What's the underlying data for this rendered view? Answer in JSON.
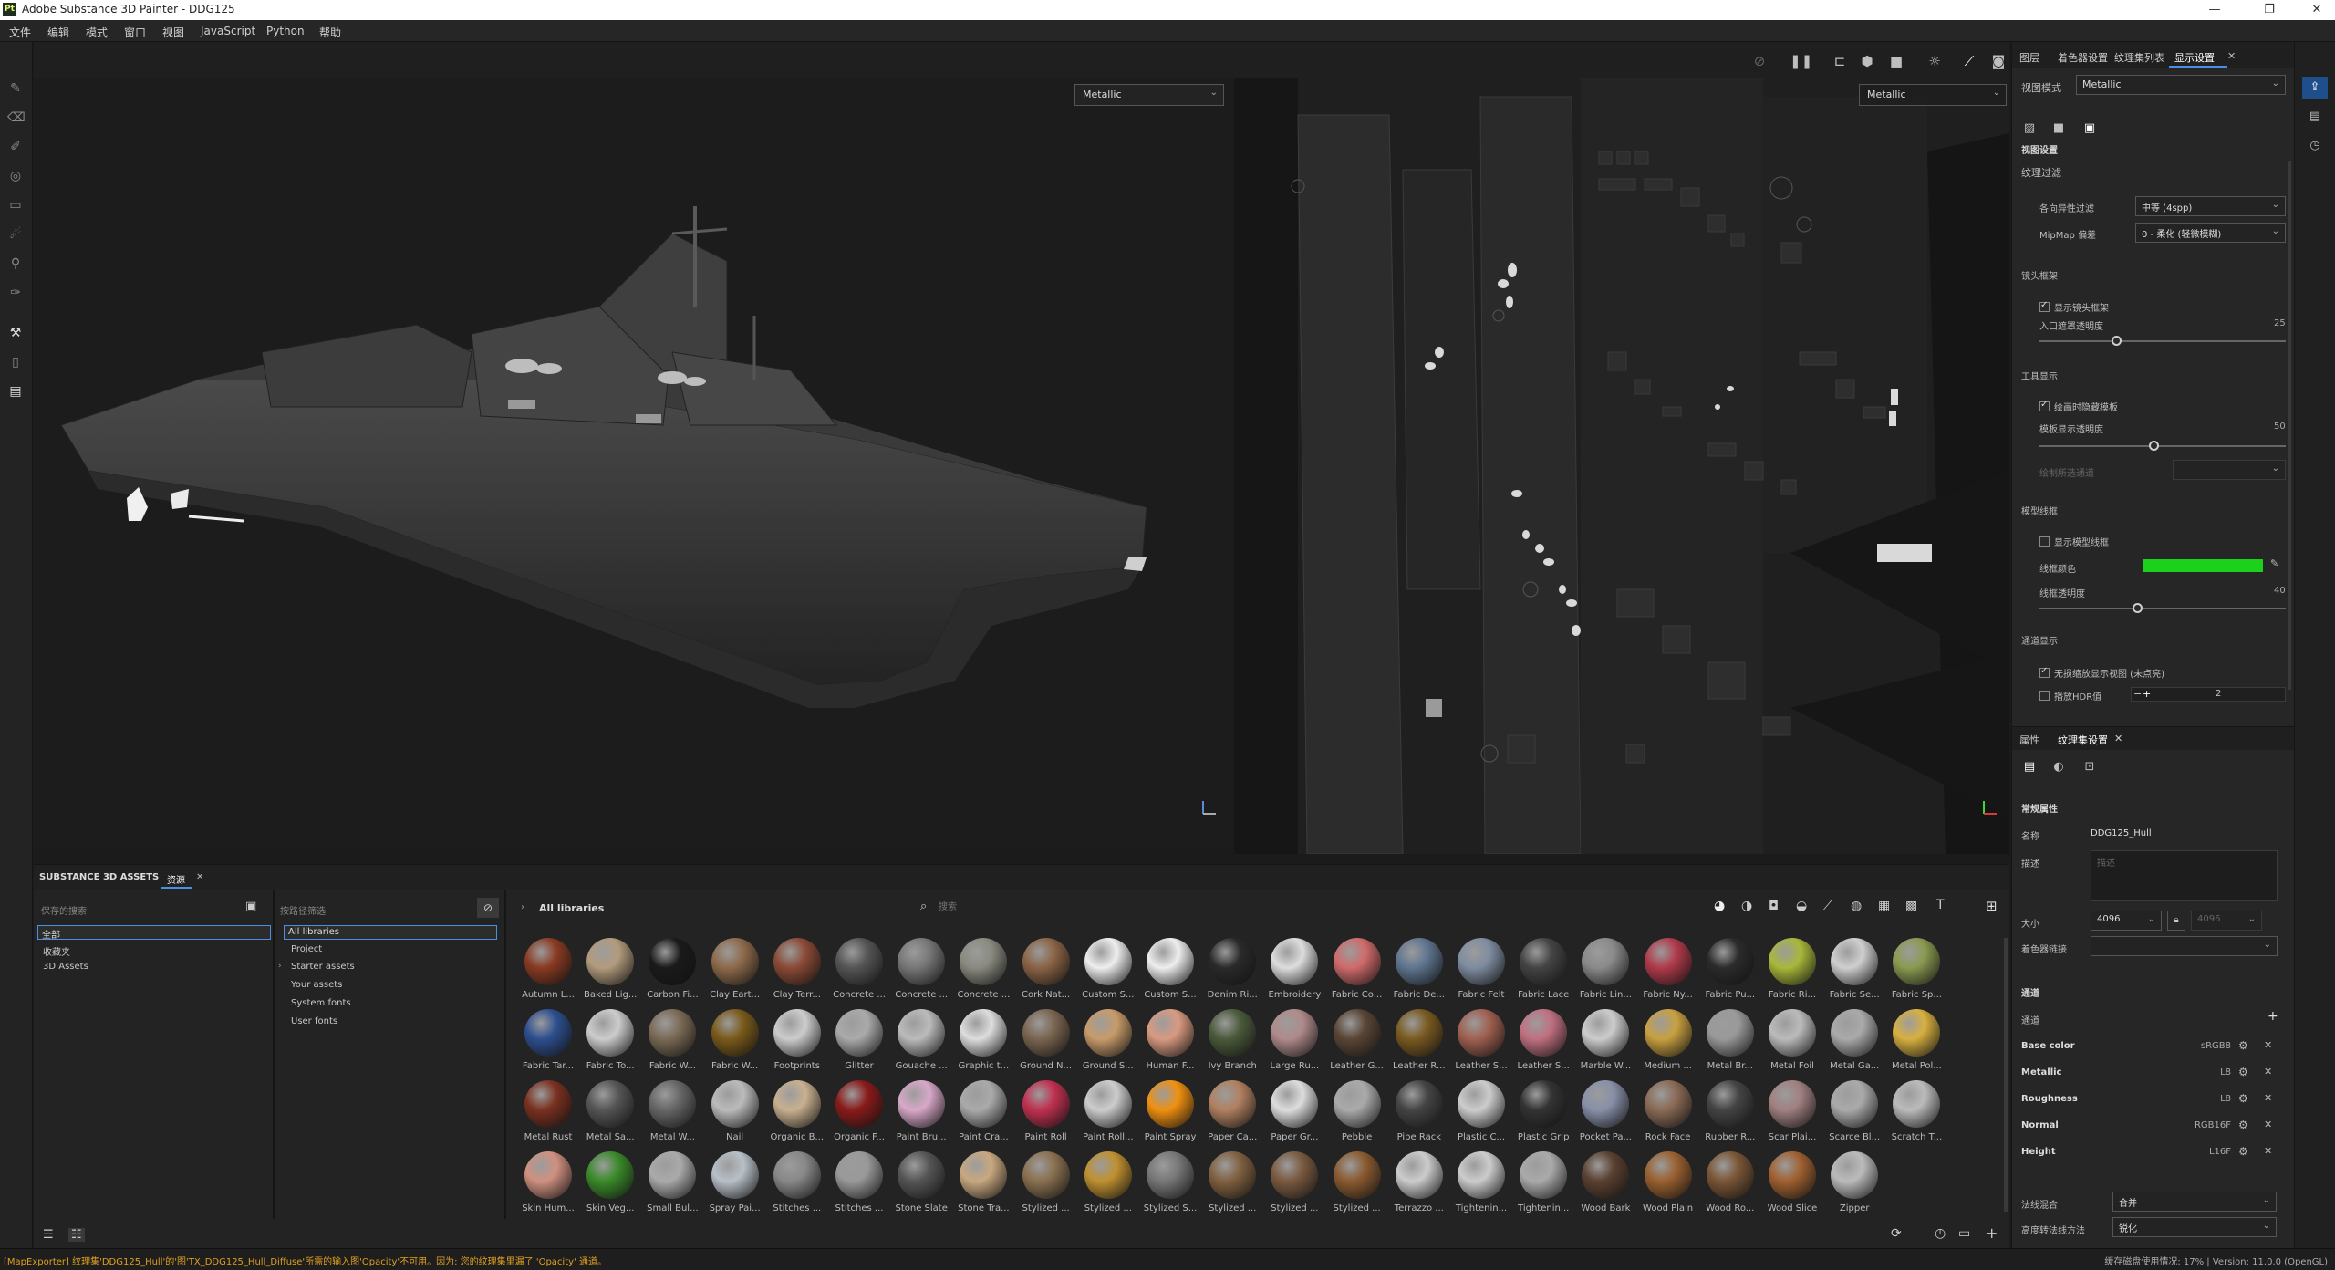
{
  "app": {
    "title": "Adobe Substance 3D Painter - DDG125",
    "logo_text": "Pt"
  },
  "window_buttons": [
    "—",
    "❐",
    "✕"
  ],
  "menu": [
    "文件",
    "编辑",
    "模式",
    "窗口",
    "视图",
    "JavaScript",
    "Python",
    "帮助"
  ],
  "viewport": {
    "left_mode": "Metallic",
    "right_mode": "Metallic"
  },
  "right_panel": {
    "tabs": [
      "图层",
      "着色器设置",
      "纹理集列表",
      "显示设置"
    ],
    "view_mode_label": "视图模式",
    "view_mode_value": "Metallic",
    "subheader": "视图设置",
    "texture_filter_title": "纹理过滤",
    "aniso_label": "各向异性过滤",
    "aniso_value": "中等 (4spp)",
    "mipmap_label": "MipMap 偏差",
    "mipmap_value": "0 - 柔化 (轻微模糊)",
    "camera_frame_title": "镜头框架",
    "show_frame_label": "显示镜头框架",
    "frame_opacity_label": "入口遮罩透明度",
    "frame_opacity_value": "25",
    "tool_display_title": "工具显示",
    "hide_template_label": "绘画时隐藏模板",
    "template_opacity_label": "模板显示透明度",
    "template_opacity_value": "50",
    "paint_channel_label": "绘制所选通道",
    "wireframe_title": "模型线框",
    "show_wireframe_label": "显示模型线框",
    "wire_color_label": "线框颜色",
    "wire_color": "#1bd11b",
    "wire_opacity_label": "线框透明度",
    "wire_opacity_value": "40",
    "channel_display_title": "通道显示",
    "isolate_label": "无损缩放显示视图 (未点亮)",
    "hdr_label": "播放HDR值",
    "hdr_value": "2"
  },
  "props_panel": {
    "tabs": [
      "属性",
      "纹理集设置"
    ],
    "general_title": "常规属性",
    "name_label": "名称",
    "name_value": "DDG125_Hull",
    "desc_label": "描述",
    "desc_placeholder": "描述",
    "size_label": "大小",
    "size_value": "4096",
    "size_value2": "4096",
    "shader_link_label": "着色器链接",
    "channels_title": "通道",
    "channels_label": "通道",
    "channels": [
      {
        "name": "Base color",
        "format": "sRGB8"
      },
      {
        "name": "Metallic",
        "format": "L8"
      },
      {
        "name": "Roughness",
        "format": "L8"
      },
      {
        "name": "Normal",
        "format": "RGB16F"
      },
      {
        "name": "Height",
        "format": "L16F"
      }
    ],
    "normal_mix_label": "法线混合",
    "normal_mix_value": "合并",
    "normal_orient_label": "高度转法线方法",
    "normal_orient_value": "锐化"
  },
  "assets": {
    "tabs": [
      "SUBSTANCE 3D ASSETS",
      "资源"
    ],
    "saved_search_label": "保存的搜索",
    "filter_label": "按路径筛选",
    "left_list": [
      "全部",
      "收藏夹",
      "3D Assets"
    ],
    "libraries": [
      "All libraries",
      "Project",
      "Starter assets",
      "Your assets",
      "System fonts",
      "User fonts"
    ],
    "breadcrumb": "All libraries",
    "search_placeholder": "搜索",
    "items": [
      [
        "Autumn L...",
        "#8a3a22"
      ],
      [
        "Baked Lig...",
        "#b39b7d"
      ],
      [
        "Carbon Fi...",
        "#1a1a1a"
      ],
      [
        "Clay Eart...",
        "#8d6a4a"
      ],
      [
        "Clay Terr...",
        "#8a4a35"
      ],
      [
        "Concrete ...",
        "#555555"
      ],
      [
        "Concrete ...",
        "#777777"
      ],
      [
        "Concrete ...",
        "#8a8a80"
      ],
      [
        "Cork Nat...",
        "#8a6345"
      ],
      [
        "Custom S...",
        "#eeeeee"
      ],
      [
        "Custom S...",
        "#eeeeee"
      ],
      [
        "Denim Ri...",
        "#2a2a2a"
      ],
      [
        "Embroidery",
        "#dddddd"
      ],
      [
        "Fabric Co...",
        "#d06a6a"
      ],
      [
        "Fabric De...",
        "#5f7590"
      ],
      [
        "Fabric Felt",
        "#7f8ca0"
      ],
      [
        "Fabric Lace",
        "#444444"
      ],
      [
        "Fabric Lin...",
        "#8a8a8a"
      ],
      [
        "Fabric Ny...",
        "#b03a4a"
      ],
      [
        "Fabric Pu...",
        "#2b2b2b"
      ],
      [
        "Fabric Ri...",
        "#a8b83a"
      ],
      [
        "Fabric Se...",
        "#cfcfcf"
      ],
      [
        "Fabric Sp...",
        "#8a9a50"
      ],
      [
        "Fabric Tar...",
        "#2d4f8f"
      ],
      [
        "Fabric To...",
        "#cccccc"
      ],
      [
        "Fabric W...",
        "#7a6a55"
      ],
      [
        "Fabric W...",
        "#7a5a1a"
      ],
      [
        "Footprints",
        "#cccccc"
      ],
      [
        "Glitter",
        "#aaaaaa"
      ],
      [
        "Gouache ...",
        "#bbbbbb"
      ],
      [
        "Graphic t...",
        "#dddddd"
      ],
      [
        "Ground N...",
        "#7a6550"
      ],
      [
        "Ground S...",
        "#c89b6a"
      ],
      [
        "Human F...",
        "#d99a80"
      ],
      [
        "Ivy Branch",
        "#4a5a3a"
      ],
      [
        "Large Ru...",
        "#b08a8a"
      ],
      [
        "Leather G...",
        "#5a4535"
      ],
      [
        "Leather R...",
        "#7a5a20"
      ],
      [
        "Leather S...",
        "#a06050"
      ],
      [
        "Leather S...",
        "#c07080"
      ],
      [
        "Marble W...",
        "#cccccc"
      ],
      [
        "Medium ...",
        "#c8a040"
      ],
      [
        "Metal Br...",
        "#999999"
      ],
      [
        "Metal Foil",
        "#bbbbbb"
      ],
      [
        "Metal Ga...",
        "#aaaaaa"
      ],
      [
        "Metal Pol...",
        "#d8b040"
      ],
      [
        "Metal Rust",
        "#7a3020"
      ],
      [
        "Metal Sa...",
        "#555555"
      ],
      [
        "Metal W...",
        "#666666"
      ],
      [
        "Nail",
        "#bbbbbb"
      ],
      [
        "Organic B...",
        "#c8b090"
      ],
      [
        "Organic F...",
        "#8a1a1a"
      ],
      [
        "Paint Bru...",
        "#d8a8c8"
      ],
      [
        "Paint Cra...",
        "#aaaaaa"
      ],
      [
        "Paint Roll",
        "#c03050"
      ],
      [
        "Paint Roll...",
        "#cccccc"
      ],
      [
        "Paint Spray",
        "#f09010"
      ],
      [
        "Paper Ca...",
        "#b08060"
      ],
      [
        "Paper Gr...",
        "#dddddd"
      ],
      [
        "Pebble",
        "#aaaaaa"
      ],
      [
        "Pipe Rack",
        "#444444"
      ],
      [
        "Plastic C...",
        "#cccccc"
      ],
      [
        "Plastic Grip",
        "#333333"
      ],
      [
        "Pocket Pa...",
        "#8890a8"
      ],
      [
        "Rock Face",
        "#8a6a55"
      ],
      [
        "Rubber R...",
        "#444444"
      ],
      [
        "Scar Plai...",
        "#a08080"
      ],
      [
        "Scarce Bl...",
        "#aaaaaa"
      ],
      [
        "Scratch T...",
        "#bbbbbb"
      ],
      [
        "Skin Hum...",
        "#d09080"
      ],
      [
        "Skin Veg...",
        "#3a8a2a"
      ],
      [
        "Small Bul...",
        "#aaaaaa"
      ],
      [
        "Spray Pai...",
        "#b8c0c8"
      ],
      [
        "Stitches ...",
        "#888888"
      ],
      [
        "Stitches ...",
        "#999999"
      ],
      [
        "Stone Slate",
        "#555555"
      ],
      [
        "Stone Tra...",
        "#c8a880"
      ],
      [
        "Stylized ...",
        "#8a7050"
      ],
      [
        "Stylized ...",
        "#c09030"
      ],
      [
        "Stylized S...",
        "#777777"
      ],
      [
        "Stylized ...",
        "#806040"
      ],
      [
        "Stylized ...",
        "#7a5a40"
      ],
      [
        "Stylized ...",
        "#8a5a30"
      ],
      [
        "Terrazzo ...",
        "#cccccc"
      ],
      [
        "Tightenin...",
        "#cccccc"
      ],
      [
        "Tightenin...",
        "#aaaaaa"
      ],
      [
        "Wood Bark",
        "#5a4030"
      ],
      [
        "Wood Plain",
        "#9a6030"
      ],
      [
        "Wood Ro...",
        "#7a5535"
      ],
      [
        "Wood Slice",
        "#a06030"
      ],
      [
        "Zipper",
        "#bbbbbb"
      ]
    ]
  },
  "status": {
    "message": "[MapExporter] 纹理集'DDG125_Hull'的'图'TX_DDG125_Hull_Diffuse'所需的输入图'Opacity'不可用。因为: 您的纹理集里漏了 'Opacity' 通道。",
    "right": "缓存磁盘使用情况: 17% | Version: 11.0.0 (OpenGL)"
  }
}
